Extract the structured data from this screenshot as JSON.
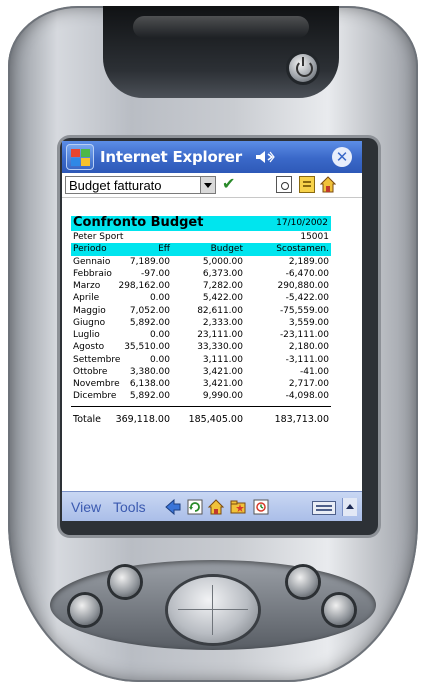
{
  "browser": {
    "title": "Internet Explorer",
    "close_glyph": "✕",
    "address_value": "Budget fatturato",
    "go_glyph": "✔"
  },
  "report": {
    "title": "Confronto Budget",
    "date": "17/10/2002",
    "company": "Peter Sport",
    "company_code": "15001",
    "columns": [
      "Periodo",
      "Eff",
      "Budget",
      "Scostamen."
    ],
    "rows": [
      [
        "Gennaio",
        "7,189.00",
        "5,000.00",
        "2,189.00"
      ],
      [
        "Febbraio",
        "-97.00",
        "6,373.00",
        "-6,470.00"
      ],
      [
        "Marzo",
        "298,162.00",
        "7,282.00",
        "290,880.00"
      ],
      [
        "Aprile",
        "0.00",
        "5,422.00",
        "-5,422.00"
      ],
      [
        "Maggio",
        "7,052.00",
        "82,611.00",
        "-75,559.00"
      ],
      [
        "Giugno",
        "5,892.00",
        "2,333.00",
        "3,559.00"
      ],
      [
        "Luglio",
        "0.00",
        "23,111.00",
        "-23,111.00"
      ],
      [
        "Agosto",
        "35,510.00",
        "33,330.00",
        "2,180.00"
      ],
      [
        "Settembre",
        "0.00",
        "3,111.00",
        "-3,111.00"
      ],
      [
        "Ottobre",
        "3,380.00",
        "3,421.00",
        "-41.00"
      ],
      [
        "Novembre",
        "6,138.00",
        "3,421.00",
        "2,717.00"
      ],
      [
        "Dicembre",
        "5,892.00",
        "9,990.00",
        "-4,098.00"
      ]
    ],
    "total": [
      "Totale",
      "369,118.00",
      "185,405.00",
      "183,713.00"
    ]
  },
  "command_bar": {
    "view_label": "View",
    "tools_label": "Tools"
  },
  "colors": {
    "titlebar": "#3a68c8",
    "report_header": "#00e5ee",
    "command_bar": "#a9bde8",
    "command_text": "#3b5ab0"
  },
  "icons": [
    "windows-logo-icon",
    "speaker-icon",
    "close-icon",
    "dropdown-arrow-icon",
    "go-check-icon",
    "page-icon",
    "notes-icon",
    "home-icon",
    "back-arrow-icon",
    "refresh-icon",
    "favorites-icon",
    "history-icon",
    "keyboard-icon",
    "sip-up-arrow-icon",
    "power-icon"
  ]
}
